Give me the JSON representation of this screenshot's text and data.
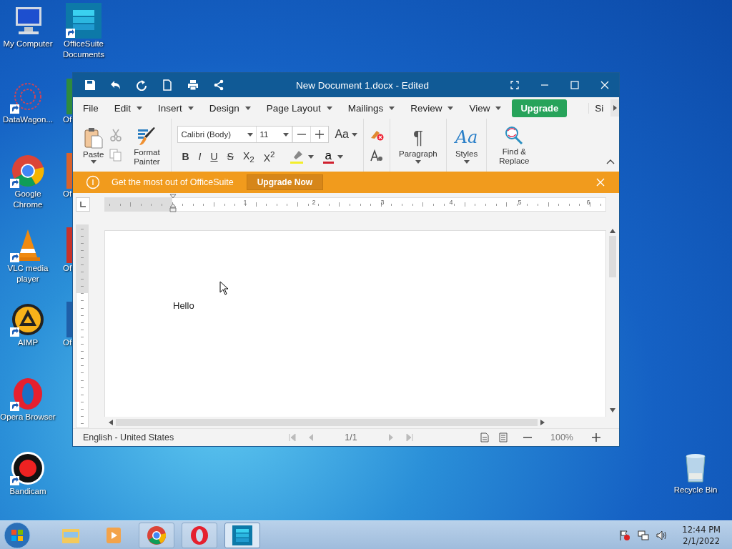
{
  "desktop_icons": [
    {
      "label": "My Computer",
      "kind": "computer",
      "shortcut": false
    },
    {
      "label": "OfficeSuite Documents",
      "kind": "officesuite",
      "shortcut": true
    },
    {
      "label": "DataWagon...",
      "kind": "datawagon",
      "shortcut": true
    },
    {
      "label": "Google Chrome",
      "kind": "chrome",
      "shortcut": true
    },
    {
      "label": "VLC media player",
      "kind": "vlc",
      "shortcut": true
    },
    {
      "label": "AIMP",
      "kind": "aimp",
      "shortcut": true
    },
    {
      "label": "Opera Browser",
      "kind": "opera",
      "shortcut": true
    },
    {
      "label": "Bandicam",
      "kind": "bandicam",
      "shortcut": true
    },
    {
      "label": "Recycle Bin",
      "kind": "recycle",
      "shortcut": false
    }
  ],
  "partial_icons": [
    {
      "label": "Of",
      "color": "#2e8b3e"
    },
    {
      "label": "Of",
      "color": "#d9622b"
    },
    {
      "label": "Of",
      "color": "#c8322a"
    },
    {
      "label": "Of",
      "color": "#1f5fa8"
    }
  ],
  "window": {
    "title": "New Document 1.docx - Edited",
    "menu": [
      {
        "label": "File",
        "dropdown": false
      },
      {
        "label": "Edit",
        "dropdown": true
      },
      {
        "label": "Insert",
        "dropdown": true
      },
      {
        "label": "Design",
        "dropdown": true
      },
      {
        "label": "Page Layout",
        "dropdown": true
      },
      {
        "label": "Mailings",
        "dropdown": true
      },
      {
        "label": "Review",
        "dropdown": true
      },
      {
        "label": "View",
        "dropdown": true
      }
    ],
    "upgrade_button": "Upgrade",
    "menu_overflow": "Si",
    "ribbon": {
      "paste": "Paste",
      "format_painter": "Format Painter",
      "font": "Calibri (Body)",
      "size": "11",
      "change_case": "Aa",
      "format_buttons": [
        {
          "label": "B",
          "kind": "bold"
        },
        {
          "label": "I",
          "kind": "italic"
        },
        {
          "label": "U",
          "kind": "underline"
        },
        {
          "label": "S",
          "kind": "strike"
        },
        {
          "label": "X$_{2}$",
          "kind": "plain"
        },
        {
          "label": "X$^{2}$",
          "kind": "plain"
        }
      ],
      "font_color_letter": "a",
      "paragraph": "Paragraph",
      "paragraph_mark": "¶",
      "styles_icon": "Aa",
      "styles": "Styles",
      "find_replace": "Find & Replace"
    },
    "banner": {
      "message": "Get the most out of OfficeSuite",
      "button": "Upgrade Now"
    },
    "ruler": {
      "numbers": [
        "1",
        "2",
        "3",
        "4",
        "5",
        "6"
      ]
    },
    "document": {
      "text": "Hello"
    },
    "status_bar": {
      "language": "English - United States",
      "page": "1/1",
      "zoom": "100%"
    }
  },
  "taskbar": {
    "apps": [
      {
        "kind": "explorer",
        "selected": false,
        "running": false
      },
      {
        "kind": "media",
        "selected": false,
        "running": false
      },
      {
        "kind": "chrome",
        "selected": false,
        "running": true
      },
      {
        "kind": "opera",
        "selected": false,
        "running": true
      },
      {
        "kind": "officesuite",
        "selected": true,
        "running": true
      }
    ],
    "time": "12:44 PM",
    "date": "2/1/2022"
  }
}
